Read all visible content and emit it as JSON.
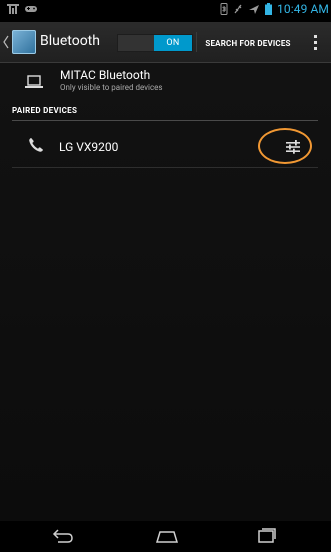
{
  "status_bar": {
    "time": "10:49 AM",
    "icons": [
      "signal-icon",
      "gamepad-icon",
      "bluetooth-icon",
      "vibrate-icon",
      "airplane-icon",
      "battery-icon"
    ]
  },
  "action_bar": {
    "title": "Bluetooth",
    "toggle_state": "ON",
    "search_label": "SEARCH FOR DEVICES"
  },
  "this_device": {
    "name": "MITAC Bluetooth",
    "visibility": "Only visible to paired devices"
  },
  "paired_section": {
    "header": "PAIRED DEVICES",
    "devices": [
      {
        "name": "LG VX9200"
      }
    ]
  },
  "colors": {
    "accent": "#33b5e5",
    "toggle_on": "#0099cc",
    "highlight": "#f19833"
  }
}
